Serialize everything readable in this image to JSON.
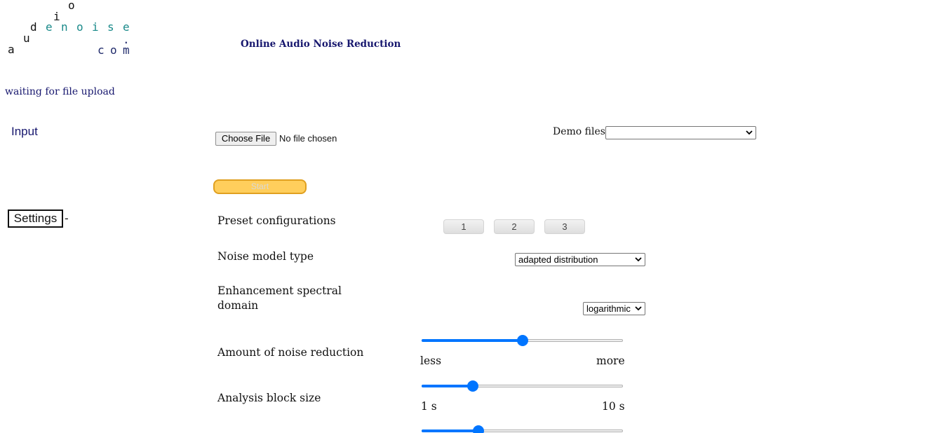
{
  "logo": {
    "chars": {
      "o": "o",
      "i": "i",
      "d": "d",
      "e1": "e",
      "n": "n",
      "o2": "o",
      "i2": "i",
      "s": "s",
      "e2": "e",
      "u": "u",
      "a": "a",
      "dot": ".",
      "c": "c",
      "o3": "o",
      "m": "m"
    }
  },
  "header": {
    "title": "Online Audio Noise Reduction"
  },
  "status": {
    "text": "waiting for file upload"
  },
  "input": {
    "label": "Input",
    "choose_file_label": "Choose File",
    "file_status": "No file chosen",
    "demo_label": "Demo files",
    "demo_selected": "",
    "start_label": "Start"
  },
  "settings": {
    "label": "Settings",
    "toggle": "-",
    "preset_label": "Preset configurations",
    "presets": [
      "1",
      "2",
      "3"
    ],
    "noise_model_label": "Noise model type",
    "noise_model_value": "adapted distribution",
    "domain_label_line1": "Enhancement spectral",
    "domain_label_line2": "domain",
    "domain_value": "logarithmic",
    "reduction_label": "Amount of noise reduction",
    "reduction_min": "less",
    "reduction_max": "more",
    "reduction_value": 0.5,
    "block_label": "Analysis block size",
    "block_min": "1 s",
    "block_max": "10 s",
    "block_value": 0.24,
    "third_slider_value": 0.27
  },
  "colors": {
    "accent": "#0075ff",
    "title_navy": "#17176e",
    "logo_teal": "#1a8a8a",
    "start_fill": "#ffce5c"
  }
}
